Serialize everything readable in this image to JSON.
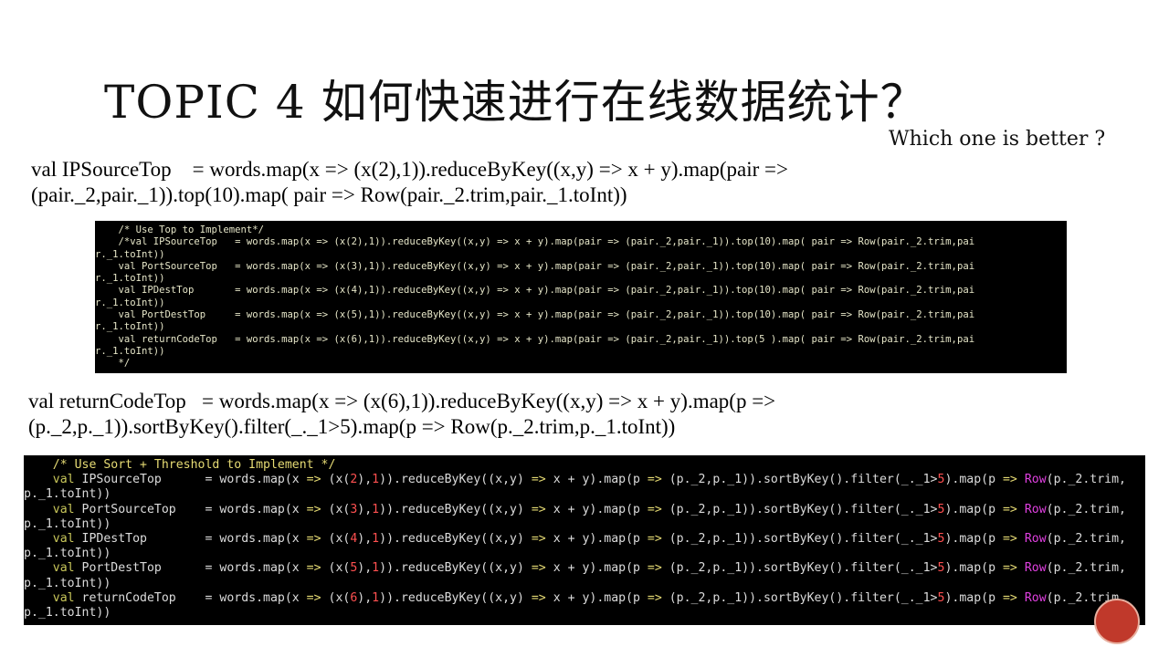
{
  "title": "TOPIC 4 如何快速进行在线数据统计？",
  "subtitle": "Which one is better ?",
  "text1": "val IPSourceTop    = words.map(x => (x(2),1)).reduceByKey((x,y) => x + y).map(pair =>\n(pair._2,pair._1)).top(10).map( pair => Row(pair._2.trim,pair._1.toInt))",
  "text2": "val returnCodeTop   = words.map(x => (x(6),1)).reduceByKey((x,y) => x + y).map(p =>\n(p._2,p._1)).sortByKey().filter(_._1>5).map(p => Row(p._2.trim,p._1.toInt))",
  "code1": {
    "lines": [
      "    /* Use Top to Implement*/",
      "    /*val IPSourceTop   = words.map(x => (x(2),1)).reduceByKey((x,y) => x + y).map(pair => (pair._2,pair._1)).top(10).map( pair => Row(pair._2.trim,pai",
      "r._1.toInt))",
      "    val PortSourceTop   = words.map(x => (x(3),1)).reduceByKey((x,y) => x + y).map(pair => (pair._2,pair._1)).top(10).map( pair => Row(pair._2.trim,pai",
      "r._1.toInt))",
      "    val IPDestTop       = words.map(x => (x(4),1)).reduceByKey((x,y) => x + y).map(pair => (pair._2,pair._1)).top(10).map( pair => Row(pair._2.trim,pai",
      "r._1.toInt))",
      "    val PortDestTop     = words.map(x => (x(5),1)).reduceByKey((x,y) => x + y).map(pair => (pair._2,pair._1)).top(10).map( pair => Row(pair._2.trim,pai",
      "r._1.toInt))",
      "    val returnCodeTop   = words.map(x => (x(6),1)).reduceByKey((x,y) => x + y).map(pair => (pair._2,pair._1)).top(5 ).map( pair => Row(pair._2.trim,pai",
      "r._1.toInt))",
      "    */"
    ]
  },
  "code2": {
    "comment": "    /* Use Sort + Threshold to Implement */",
    "rows": [
      {
        "name": "IPSourceTop    ",
        "col": "2",
        "wrap": "p._1.toInt))"
      },
      {
        "name": "PortSourceTop  ",
        "col": "3",
        "wrap": "p._1.toInt))"
      },
      {
        "name": "IPDestTop      ",
        "col": "4",
        "wrap": "p._1.toInt))"
      },
      {
        "name": "PortDestTop    ",
        "col": "5",
        "wrap": "p._1.toInt))"
      },
      {
        "name": "returnCodeTop  ",
        "col": "6",
        "wrap": "p._1.toInt))"
      }
    ]
  },
  "colors": {
    "code_background": "#000000",
    "keyword": "#c8c65a",
    "number": "#ff5050",
    "function": "#e040e0",
    "accent_circle": "#c0392b"
  }
}
